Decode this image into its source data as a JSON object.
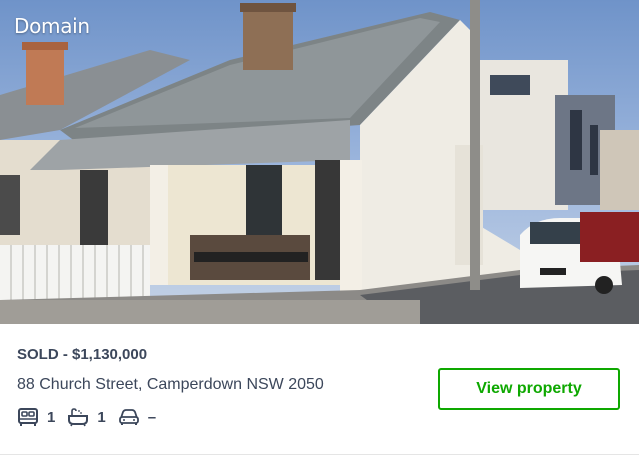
{
  "brand": {
    "name": "Domain"
  },
  "listing": {
    "status_price": "SOLD - $1,130,000",
    "address": "88 Church Street, Camperdown NSW 2050",
    "features": [
      {
        "icon": "bed-icon",
        "value": "1"
      },
      {
        "icon": "bath-icon",
        "value": "1"
      },
      {
        "icon": "car-icon",
        "value": "–"
      }
    ],
    "cta_label": "View property"
  },
  "colors": {
    "accent_green": "#0ea800",
    "text_dark": "#3c475b"
  }
}
